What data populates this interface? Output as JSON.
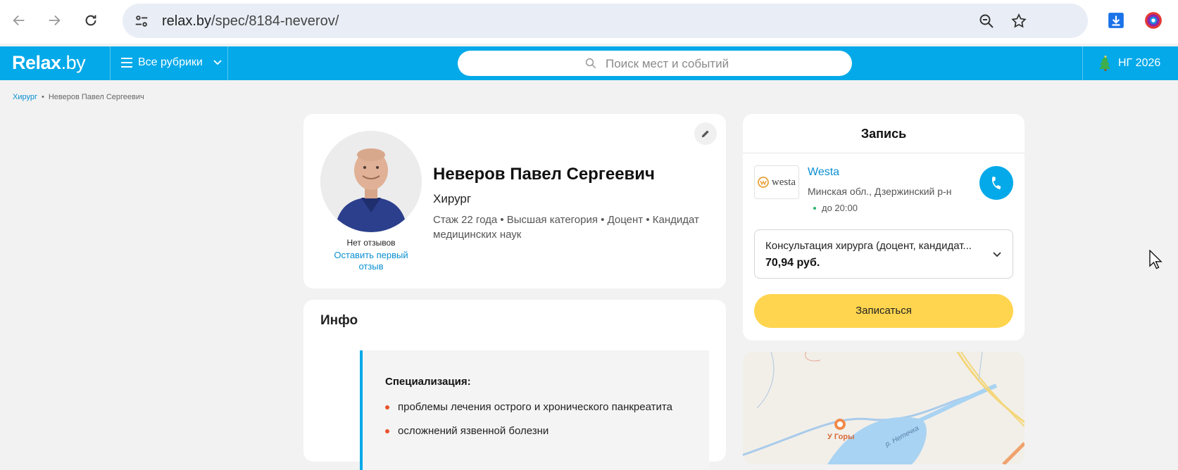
{
  "browser": {
    "url_host": "relax.by",
    "url_path": "/spec/8184-neverov/"
  },
  "header": {
    "logo_main": "Relax",
    "logo_tld": ".by",
    "rubrics_label": "Все рубрики",
    "search_placeholder": "Поиск мест и событий",
    "ng_label": "НГ 2026"
  },
  "breadcrumb": {
    "items": [
      "Хирург",
      "Неверов Павел Сергеевич"
    ]
  },
  "profile": {
    "name": "Неверов Павел Сергеевич",
    "specialty": "Хирург",
    "meta": "Стаж 22 года  •  Высшая категория • Доцент • Кандидат медицинских наук",
    "no_reviews": "Нет отзывов",
    "leave_review": "Оставить первый отзыв"
  },
  "info": {
    "title": "Инфо",
    "spec_heading": "Специализация:",
    "spec_items": [
      "проблемы лечения острого и хронического панкреатита",
      "осложнений язвенной болезни"
    ]
  },
  "booking": {
    "title": "Запись",
    "clinic_logo_text": "westa",
    "clinic_name": "Westa",
    "clinic_address": "Минская обл., Дзержинский р-н",
    "clinic_hours": "до 20:00",
    "service_name": "Консультация хирурга (доцент, кандидат...",
    "service_price": "70,94 руб.",
    "book_label": "Записаться"
  },
  "map": {
    "poi_label": "У Горы",
    "river_label": "р. Нетечка"
  },
  "colors": {
    "brand_blue": "#03a9e9",
    "cta_yellow": "#ffd54f",
    "bullet_orange": "#e8542b"
  }
}
